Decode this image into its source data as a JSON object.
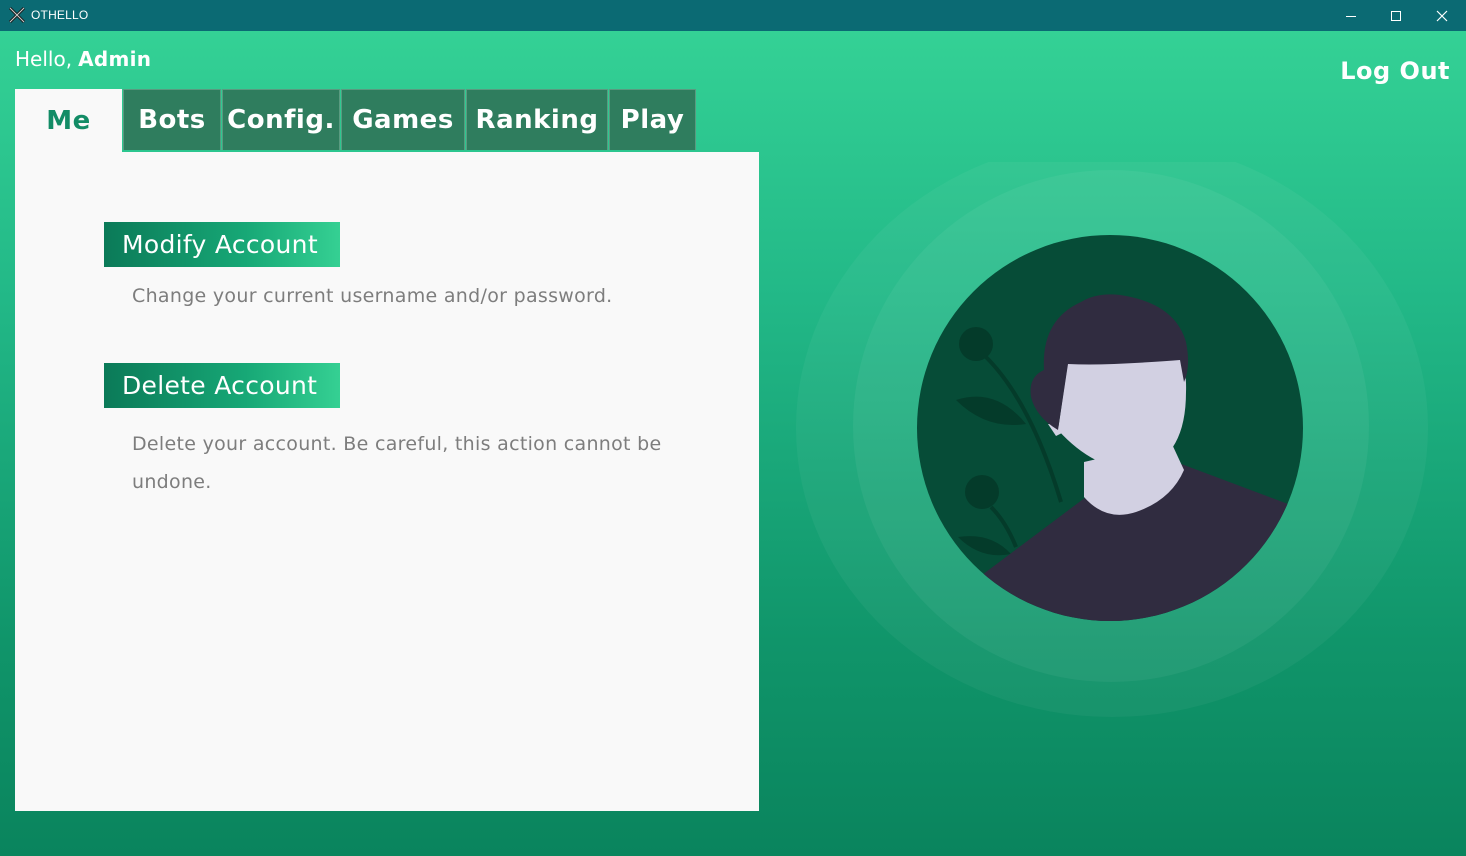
{
  "window": {
    "title": "OTHELLO",
    "controls": {
      "minimize_icon": "minimize-icon",
      "maximize_icon": "maximize-icon",
      "close_icon": "close-icon"
    }
  },
  "header": {
    "greeting": "Hello,",
    "username": "Admin",
    "logout_label": "Log Out"
  },
  "tabs": [
    {
      "label": "Me",
      "active": true
    },
    {
      "label": "Bots",
      "active": false
    },
    {
      "label": "Config.",
      "active": false
    },
    {
      "label": "Games",
      "active": false
    },
    {
      "label": "Ranking",
      "active": false
    },
    {
      "label": "Play",
      "active": false
    }
  ],
  "panel": {
    "modify": {
      "button_label": "Modify Account",
      "description": "Change your current username and/or password."
    },
    "delete": {
      "button_label": "Delete Account",
      "description": "Delete your account. Be careful, this action cannot be undone."
    }
  },
  "illustration": {
    "icon": "user-avatar-illustration"
  },
  "colors": {
    "title_bar": "#0b6a73",
    "background_top": "#36d497",
    "background_bottom": "#0a845d",
    "tab_inactive": "#2f7d5e",
    "tab_active_text": "#138c66",
    "panel": "#f9f9f9",
    "button_start": "#0b7a58",
    "button_end": "#35d093",
    "description_text": "#7d7d7d",
    "avatar_circle": "#064c37",
    "hair_shirt": "#302c40",
    "skin": "#d2d0e2"
  }
}
